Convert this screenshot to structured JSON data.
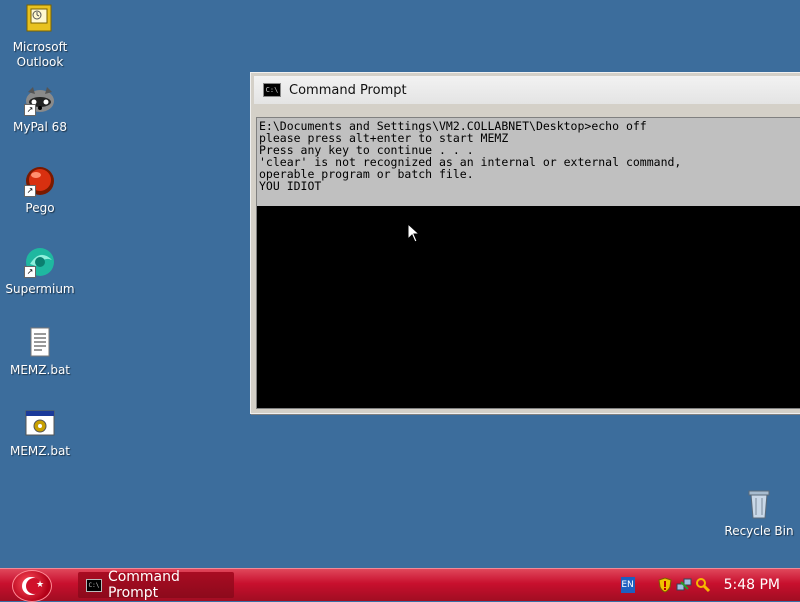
{
  "desktop": {
    "icons": [
      {
        "label": "Microsoft\nOutlook",
        "icon": "outlook-icon"
      },
      {
        "label": "MyPal 68",
        "icon": "mypal-raccoon-icon"
      },
      {
        "label": "Pego",
        "icon": "pego-red-ball-icon"
      },
      {
        "label": "Supermium",
        "icon": "supermium-icon"
      },
      {
        "label": "MEMZ.bat",
        "icon": "text-file-icon"
      },
      {
        "label": "MEMZ.bat",
        "icon": "batch-gear-icon"
      },
      {
        "label": "Recycle Bin",
        "icon": "recycle-bin-icon"
      }
    ]
  },
  "window": {
    "title": "Command Prompt",
    "icon_text": "C:\\",
    "console_lines": "E:\\Documents and Settings\\VM2.COLLABNET\\Desktop>echo off\nplease press alt+enter to start MEMZ\nPress any key to continue . . .\n'clear' is not recognized as an internal or external command,\noperable program or batch file.\nYOU IDIOT"
  },
  "taskbar": {
    "task_label": "Command Prompt",
    "language": "EN",
    "clock": "5:48 PM",
    "colors": {
      "taskbar": "#c8102e",
      "desktop": "#3c6d9c"
    }
  }
}
